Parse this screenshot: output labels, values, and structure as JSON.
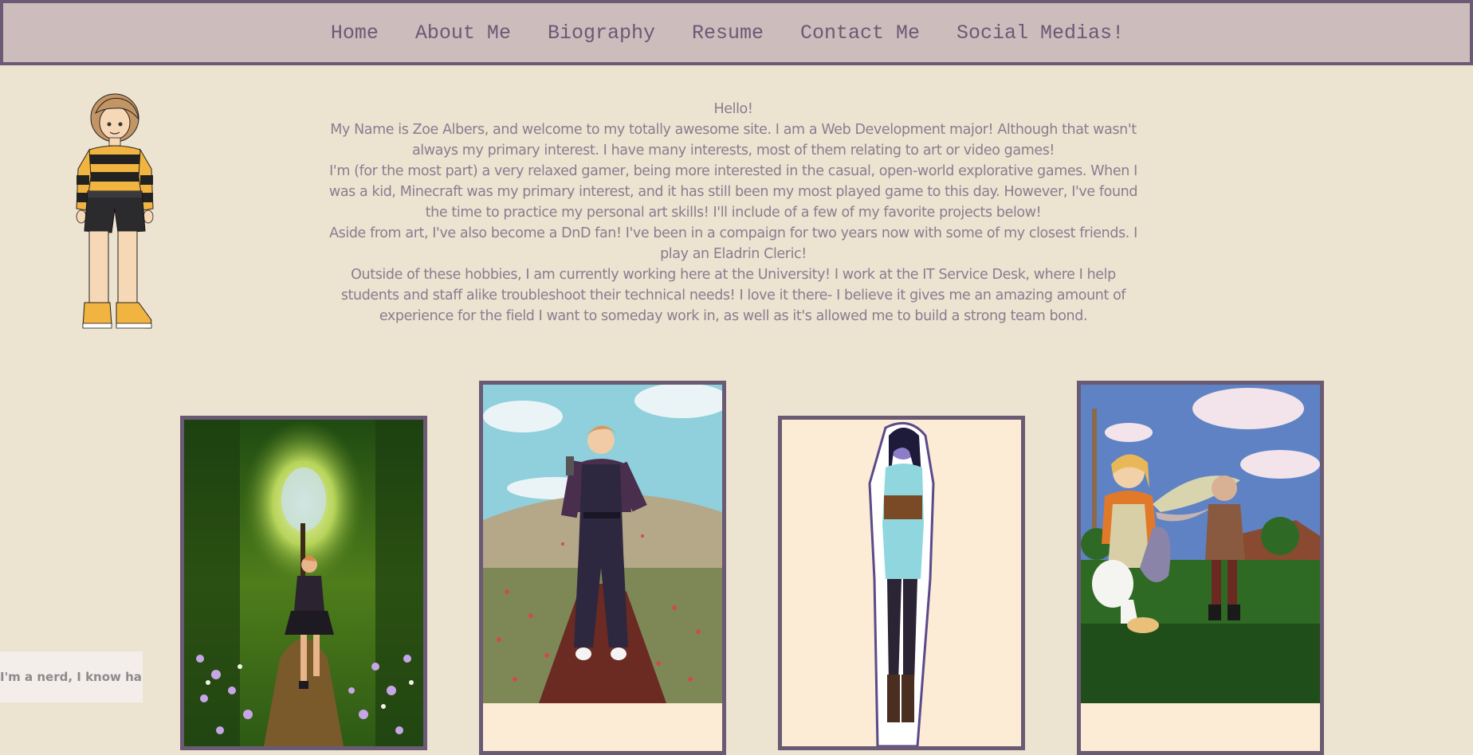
{
  "nav": {
    "items": [
      {
        "label": "Home"
      },
      {
        "label": "About Me"
      },
      {
        "label": "Biography"
      },
      {
        "label": "Resume"
      },
      {
        "label": "Contact Me"
      },
      {
        "label": "Social Medias!"
      }
    ]
  },
  "intro": {
    "paragraphs": [
      "Hello!",
      "My Name is Zoe Albers, and welcome to my totally awesome site. I am a Web Development major! Although that wasn't always my primary interest. I have many interests, most of them relating to art or video games!",
      "I'm (for the most part) a very relaxed gamer, being more interested in the casual, open-world explorative games. When I was a kid, Minecraft was my primary interest, and it has still been my most played game to this day. However, I've found the time to practice my personal art skills! I'll include of a few of my favorite projects below!",
      "Aside from art, I've also become a DnD fan! I've been in a compaign for two years now with some of my closest friends. I play an Eladrin Cleric!",
      "Outside of these hobbies, I am currently working here at the University! I work at the IT Service Desk, where I help students and staff alike troubleshoot their technical needs! I love it there- I believe it gives me an amazing amount of experience for the field I want to someday work in, as well as it's allowed me to build a strong team bond."
    ]
  },
  "toast": {
    "text": "I'm a nerd, I know haha"
  },
  "colors": {
    "background": "#ece3d0",
    "nav_background": "#cdbcbc",
    "accent": "#6a5a74",
    "text": "#8b7c90"
  }
}
